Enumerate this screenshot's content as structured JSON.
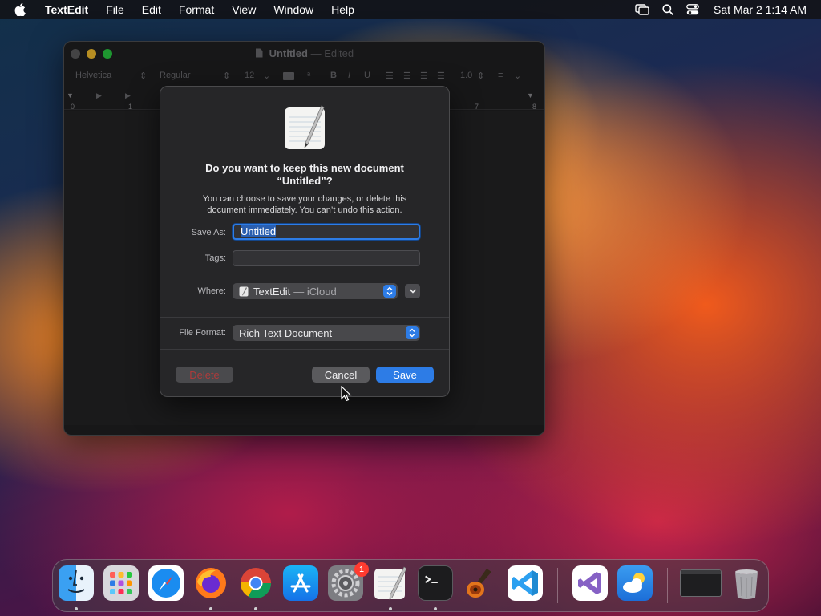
{
  "menubar": {
    "app_name": "TextEdit",
    "items": [
      "File",
      "Edit",
      "Format",
      "View",
      "Window",
      "Help"
    ],
    "clock": "Sat Mar 2  1:14 AM"
  },
  "window": {
    "title": "Untitled",
    "title_suffix": "— Edited",
    "toolbar": {
      "font_family": "Helvetica",
      "font_style": "Regular",
      "font_size": "12",
      "line_spacing": "1.0"
    },
    "ruler_ticks": [
      "0",
      "1",
      "7",
      "8"
    ],
    "document_text": ""
  },
  "sheet": {
    "title_line1": "Do you want to keep this new document",
    "title_line2": "“Untitled”?",
    "message": "You can choose to save your changes, or delete this document immediately. You can’t undo this action.",
    "save_as_label": "Save As:",
    "save_as_value": "Untitled",
    "tags_label": "Tags:",
    "tags_value": "",
    "where_label": "Where:",
    "where_app": "TextEdit",
    "where_location": "— iCloud",
    "file_format_label": "File Format:",
    "file_format_value": "Rich Text Document",
    "delete_label": "Delete",
    "cancel_label": "Cancel",
    "save_label": "Save"
  },
  "dock": {
    "settings_badge": "1",
    "apps": [
      "finder",
      "launchpad",
      "safari",
      "firefox",
      "chrome",
      "app-store",
      "system-settings",
      "textedit",
      "terminal",
      "garageband",
      "vscode",
      "visual-studio",
      "weather",
      "window-preview",
      "trash"
    ]
  },
  "colors": {
    "accent": "#2d7ce6",
    "window_bg": "#1f1f21",
    "sheet_bg": "#262628"
  }
}
